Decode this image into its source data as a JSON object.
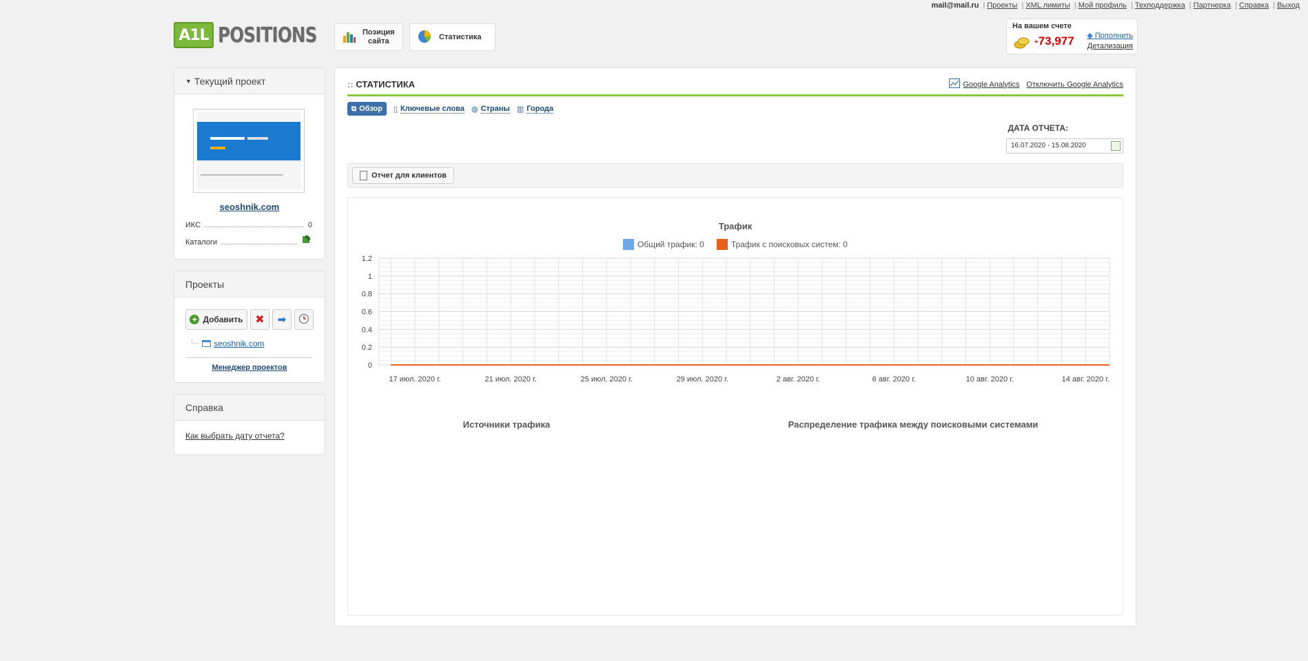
{
  "top_links": {
    "email": "mail@mail.ru",
    "links": [
      "Проекты",
      "XML лимиты",
      "Мой профиль",
      "Техподдержка",
      "Партнерка",
      "Справка",
      "Выход"
    ]
  },
  "logo": {
    "mark": "A1L",
    "text": "POSITIONS"
  },
  "top_tabs": {
    "positions_line1": "Позиция",
    "positions_line2": "сайта",
    "statistics": "Статистика"
  },
  "balance": {
    "title": "На вашем счете",
    "amount": "-73,977",
    "refill": "Пополнить",
    "details": "Детализация"
  },
  "current_project": {
    "header": "Текущий проект",
    "site": "seoshnik.com",
    "iks_label": "ИКС",
    "iks_value": "0",
    "catalogs_label": "Каталоги"
  },
  "projects": {
    "header": "Проекты",
    "add_label": "Добавить",
    "items": [
      "seoshnik.com"
    ],
    "manager_link": "Менеджер проектов"
  },
  "help": {
    "header": "Справка",
    "link": "Как выбрать дату отчета?"
  },
  "main": {
    "title": "СТАТИСТИКА",
    "ga_link": "Google Analytics",
    "ga_disconnect": "Отключить Google Analytics",
    "tabs": [
      {
        "label": "Обзор",
        "active": true
      },
      {
        "label": "Ключевые слова",
        "active": false
      },
      {
        "label": "Страны",
        "active": false
      },
      {
        "label": "Города",
        "active": false
      }
    ],
    "date_label": "ДАТА ОТЧЕТА:",
    "date_range": "16.07.2020 - 15.08.2020",
    "report_button": "Отчет для клиентов",
    "sources_title": "Источники трафика",
    "distribution_title": "Распределение трафика между поисковыми системами"
  },
  "colors": {
    "accent_green": "#8cc63f",
    "series_total": "#6fa8e6",
    "series_search": "#e8601c",
    "balance_red": "#d40000"
  },
  "chart_data": {
    "type": "line",
    "title": "Трафик",
    "legend_labels": [
      "Общий трафик: 0",
      "Трафик с поисковых систем: 0"
    ],
    "x_tick_labels": [
      "17 июл. 2020 г.",
      "21 июл. 2020 г.",
      "25 июл. 2020 г.",
      "29 июл. 2020 г.",
      "2 авг. 2020 г.",
      "6 авг. 2020 г.",
      "10 авг. 2020 г.",
      "14 авг. 2020 г."
    ],
    "x_start": "2020-07-16",
    "x_end": "2020-08-15",
    "y_ticks": [
      "0",
      "0.2",
      "0.4",
      "0.6",
      "0.8",
      "1",
      "1.2"
    ],
    "ylim": [
      0,
      1.2
    ],
    "grid": true,
    "series": [
      {
        "name": "Общий трафик",
        "color": "#6fa8e6",
        "values": [
          0,
          0,
          0,
          0,
          0,
          0,
          0,
          0,
          0,
          0,
          0,
          0,
          0,
          0,
          0,
          0,
          0,
          0,
          0,
          0,
          0,
          0,
          0,
          0,
          0,
          0,
          0,
          0,
          0,
          0,
          0
        ]
      },
      {
        "name": "Трафик с поисковых систем",
        "color": "#e8601c",
        "values": [
          0,
          0,
          0,
          0,
          0,
          0,
          0,
          0,
          0,
          0,
          0,
          0,
          0,
          0,
          0,
          0,
          0,
          0,
          0,
          0,
          0,
          0,
          0,
          0,
          0,
          0,
          0,
          0,
          0,
          0,
          0
        ]
      }
    ]
  }
}
